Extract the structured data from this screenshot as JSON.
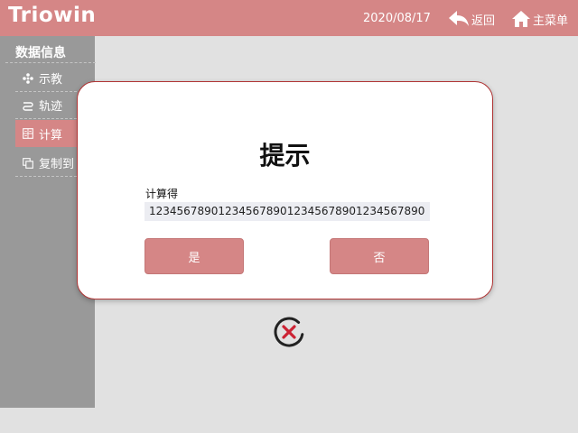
{
  "header": {
    "logo": "Triowin",
    "date": "2020/08/17",
    "back_label": "返回",
    "home_label": "主菜单"
  },
  "sidebar": {
    "title": "数据信息",
    "items": [
      {
        "label": "示教",
        "icon": "gear-icon",
        "active": false
      },
      {
        "label": "轨迹",
        "icon": "track-icon",
        "active": false
      },
      {
        "label": "计算",
        "icon": "calculator-icon",
        "active": true
      },
      {
        "label": "复制到",
        "icon": "copy-icon",
        "active": false
      }
    ]
  },
  "dialog": {
    "title": "提示",
    "label": "计算得",
    "value": "1234567890123456789012345678901234567890",
    "yes_label": "是",
    "no_label": "否"
  },
  "colors": {
    "accent": "#d58686",
    "sidebar": "#999999",
    "background": "#e1e1e1",
    "dialog_border": "#b03434",
    "close_icon": "#cc2233"
  }
}
